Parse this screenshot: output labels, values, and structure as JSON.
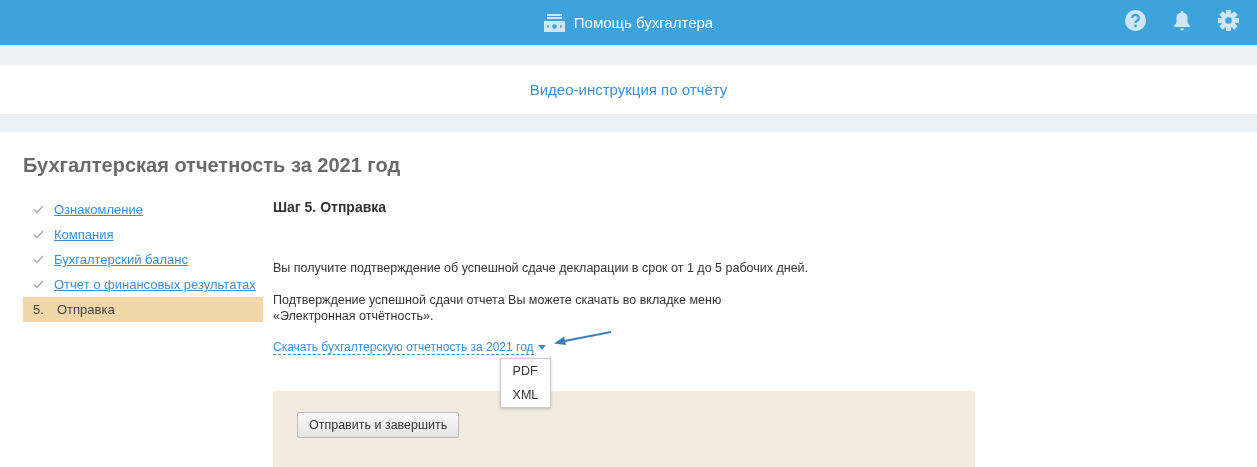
{
  "header": {
    "title": "Помощь бухгалтера"
  },
  "video_link": "Видео-инструкция по отчёту",
  "page_title": "Бухгалтерская отчетность за 2021 год",
  "steps": [
    {
      "label": "Ознакомление",
      "selected": false,
      "done": true
    },
    {
      "label": "Компания",
      "selected": false,
      "done": true
    },
    {
      "label": "Бухгалтерский баланс",
      "selected": false,
      "done": true
    },
    {
      "label": "Отчет о финансовых результатах",
      "selected": false,
      "done": true
    },
    {
      "number": "5.",
      "label": "Отправка",
      "selected": true,
      "done": false
    }
  ],
  "step_title": "Шаг 5. Отправка",
  "paragraphs": [
    "Вы получите подтверждение об успешной сдаче декларации в срок от 1 до 5 рабочих дней.",
    "Подтверждение успешной сдачи отчета Вы можете скачать во вкладке меню\n«Электронная отчётность»."
  ],
  "download_link": "Скачать бухгалтерскую отчетность за 2021 год",
  "download_menu": {
    "expanded": true,
    "items": [
      "PDF",
      "XML"
    ]
  },
  "submit_button": "Отправить и завершить"
}
